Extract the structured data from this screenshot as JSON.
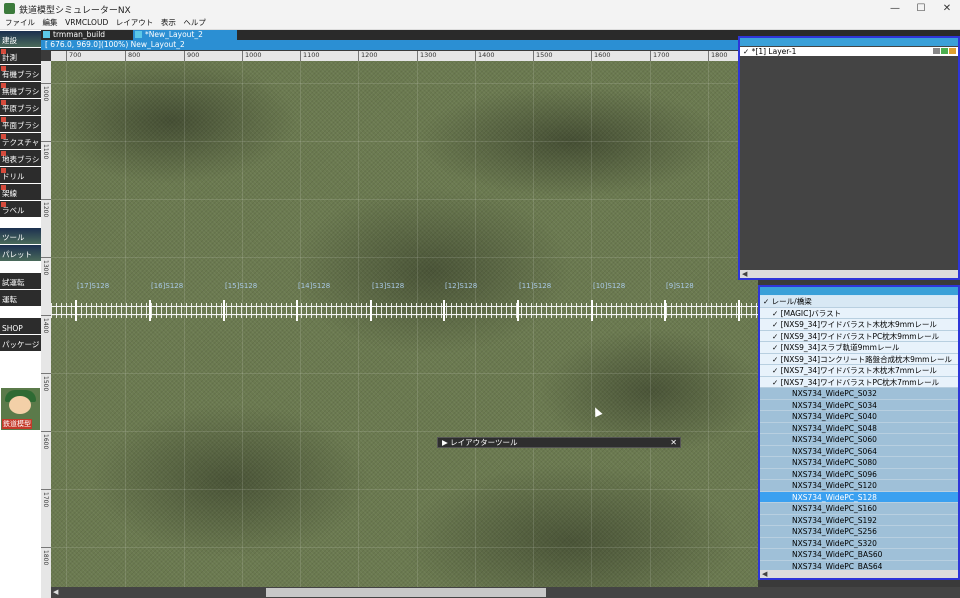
{
  "window": {
    "title": "鉄道模型シミュレーターNX",
    "minimize": "—",
    "maximize": "☐",
    "close": "✕"
  },
  "menu": [
    "ファイル",
    "編集",
    "VRMCLOUD",
    "レイアウト",
    "表示",
    "ヘルプ"
  ],
  "toolbar": [
    "建設",
    "計測",
    "有機ブラシ",
    "無機ブラシ",
    "平原ブラシ",
    "平面ブラシ",
    "テクスチャ",
    "地表ブラシ",
    "ドリル",
    "架線",
    "ラベル",
    "ツール",
    "パレット",
    "試運転",
    "運転",
    "SHOP",
    "パッケージ",
    "鉄道模型"
  ],
  "tabs": [
    {
      "label": "trmman_build"
    },
    {
      "label": "*New_Layout_2"
    }
  ],
  "status": "[ 676.0,  969.0](100%) New_Layout_2",
  "hruler": [
    "700",
    "800",
    "900",
    "1000",
    "1100",
    "1200",
    "1300",
    "1400",
    "1500",
    "1600",
    "1700",
    "1800"
  ],
  "vruler": [
    "1000",
    "1100",
    "1200",
    "1300",
    "1400",
    "1500",
    "1600",
    "1700",
    "1800"
  ],
  "segments": [
    "[17]S128",
    "[16]S128",
    "[15]S128",
    "[14]S128",
    "[13]S128",
    "[12]S128",
    "[11]S128",
    "[10]S128",
    "[9]S128"
  ],
  "layout_tool": {
    "label": "▶ レイアウターツール",
    "close": "✕"
  },
  "layers": {
    "row": "✓ *[1] Layer-1"
  },
  "parts": {
    "items": [
      {
        "label": "レール/橋梁",
        "level": 0
      },
      {
        "label": "[MAGIC]バラスト",
        "level": 1
      },
      {
        "label": "[NXS9_34]ワイドバラスト木枕木9mmレール",
        "level": 1
      },
      {
        "label": "[NXS9_34]ワイドバラストPC枕木9mmレール",
        "level": 1
      },
      {
        "label": "[NXS9_34]スラブ軌道9mmレール",
        "level": 1
      },
      {
        "label": "[NXS9_34]コンクリート路盤合成枕木9mmレール",
        "level": 1
      },
      {
        "label": "[NXS7_34]ワイドバラスト木枕木7mmレール",
        "level": 1
      },
      {
        "label": "[NXS7_34]ワイドバラストPC枕木7mmレール",
        "level": 1
      },
      {
        "label": "NXS734_WidePC_S032",
        "level": 2
      },
      {
        "label": "NXS734_WidePC_S034",
        "level": 2
      },
      {
        "label": "NXS734_WidePC_S040",
        "level": 2
      },
      {
        "label": "NXS734_WidePC_S048",
        "level": 2
      },
      {
        "label": "NXS734_WidePC_S060",
        "level": 2
      },
      {
        "label": "NXS734_WidePC_S064",
        "level": 2
      },
      {
        "label": "NXS734_WidePC_S080",
        "level": 2
      },
      {
        "label": "NXS734_WidePC_S096",
        "level": 2
      },
      {
        "label": "NXS734_WidePC_S120",
        "level": 2
      },
      {
        "label": "NXS734_WidePC_S128",
        "level": 2,
        "selected": true
      },
      {
        "label": "NXS734_WidePC_S160",
        "level": 2
      },
      {
        "label": "NXS734_WidePC_S192",
        "level": 2
      },
      {
        "label": "NXS734_WidePC_S256",
        "level": 2
      },
      {
        "label": "NXS734_WidePC_S320",
        "level": 2
      },
      {
        "label": "NXS734_WidePC_BAS60",
        "level": 2
      },
      {
        "label": "NXS734_WidePC_BAS64",
        "level": 2
      }
    ]
  },
  "colors": {
    "accent": "#2b8fd3",
    "panel_border": "#2e35d8",
    "selected": "#3aa0f0"
  }
}
